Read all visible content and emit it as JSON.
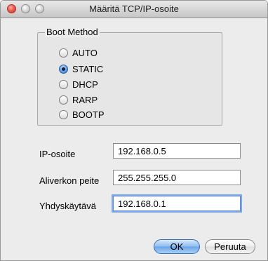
{
  "window": {
    "title": "Määritä TCP/IP-osoite"
  },
  "boot_method": {
    "legend": "Boot Method",
    "options": [
      {
        "label": "AUTO",
        "selected": false
      },
      {
        "label": "STATIC",
        "selected": true
      },
      {
        "label": "DHCP",
        "selected": false
      },
      {
        "label": "RARP",
        "selected": false
      },
      {
        "label": "BOOTP",
        "selected": false
      }
    ]
  },
  "fields": {
    "ip": {
      "label": "IP-osoite",
      "value": "192.168.0.5"
    },
    "subnet": {
      "label": "Aliverkon peite",
      "value": "255.255.255.0"
    },
    "gateway": {
      "label": "Yhdyskäytävä",
      "value": "192.168.0.1"
    }
  },
  "buttons": {
    "ok": "OK",
    "cancel": "Peruuta"
  }
}
